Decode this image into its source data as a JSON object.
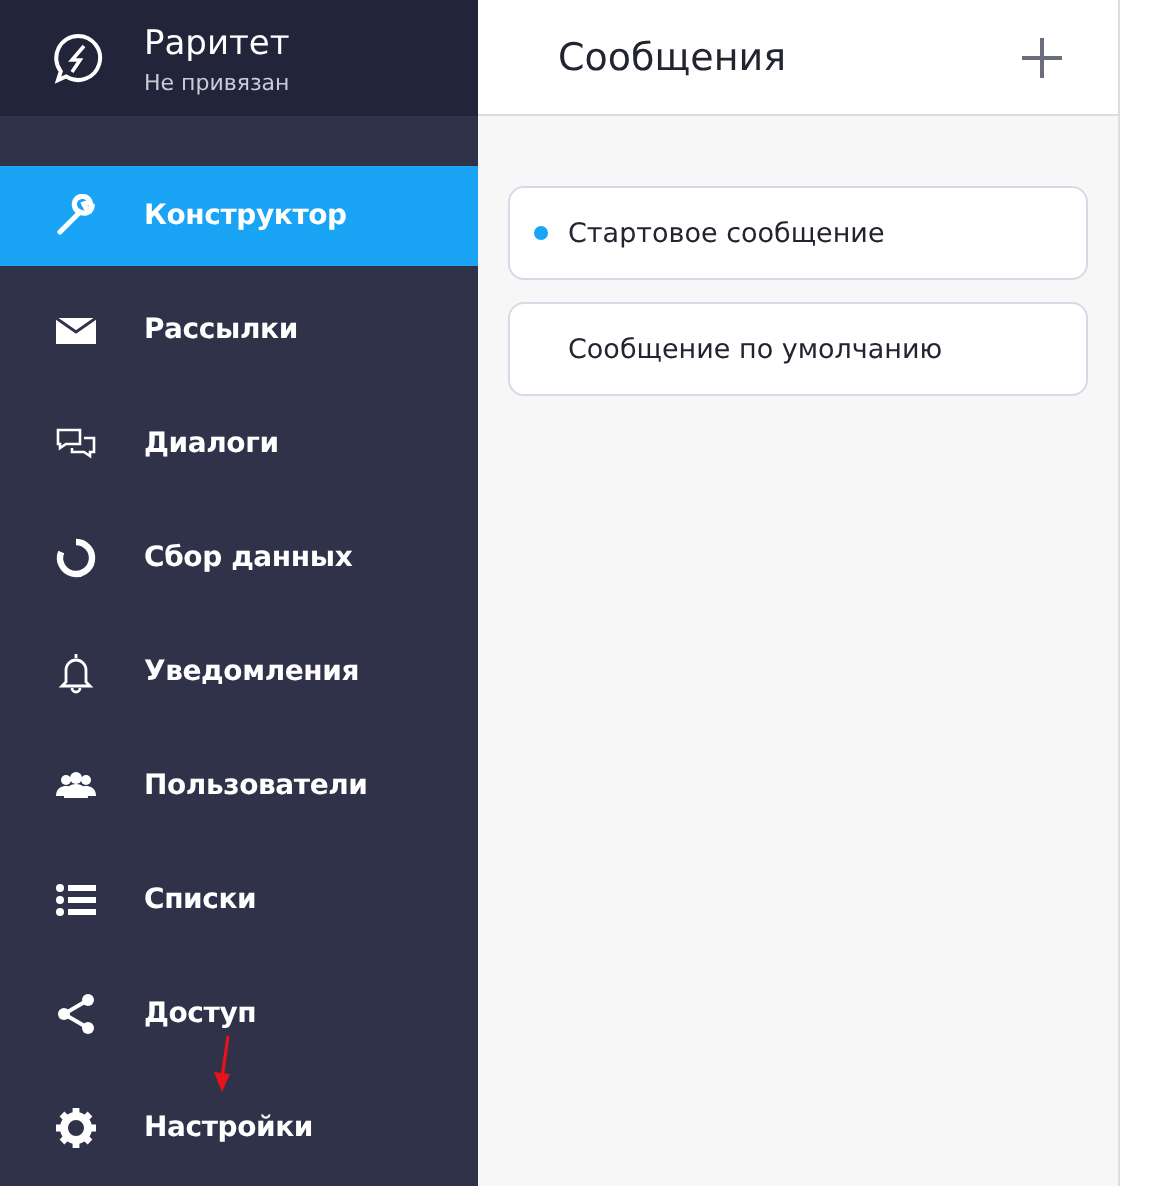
{
  "bot": {
    "name": "Раритет",
    "status": "Не привязан"
  },
  "sidebar": {
    "items": [
      {
        "label": "Конструктор",
        "selected": true
      },
      {
        "label": "Рассылки",
        "selected": false
      },
      {
        "label": "Диалоги",
        "selected": false
      },
      {
        "label": "Сбор данных",
        "selected": false
      },
      {
        "label": "Уведомления",
        "selected": false
      },
      {
        "label": "Пользователи",
        "selected": false
      },
      {
        "label": "Списки",
        "selected": false
      },
      {
        "label": "Доступ",
        "selected": false
      },
      {
        "label": "Настройки",
        "selected": false
      }
    ]
  },
  "panel": {
    "title": "Сообщения",
    "messages": [
      {
        "label": "Стартовое сообщение",
        "selected": true
      },
      {
        "label": "Сообщение по умолчанию",
        "selected": false
      }
    ]
  }
}
